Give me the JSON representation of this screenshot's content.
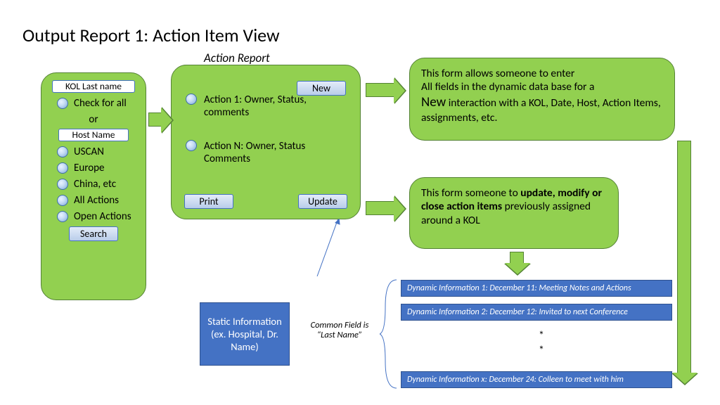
{
  "title": "Output Report 1: Action Item View",
  "action_report_label": "Action Report",
  "filters": {
    "kol_field": "KOL Last name",
    "check_all": "Check for all",
    "or": "or",
    "host_field": "Host Name",
    "regions": [
      "USCAN",
      "Europe",
      "China, etc"
    ],
    "all_actions": "All Actions",
    "open_actions": "Open Actions",
    "search": "Search"
  },
  "report": {
    "new": "New",
    "action1": "Action 1:  Owner, Status, comments",
    "actionN": "Action N: Owner, Status Comments",
    "print": "Print",
    "update": "Update"
  },
  "desc_new_1": "This form allows someone to enter",
  "desc_new_2": "All fields in the dynamic data base for a",
  "desc_new_big": "New",
  "desc_new_3": " interaction with a KOL, Date, Host, Action Items, assignments, etc.",
  "desc_update_1": "This form someone to ",
  "desc_update_bold": "update, modify or close action items",
  "desc_update_2": " previously assigned around a KOL",
  "static_info": "Static Information (ex. Hospital, Dr. Name)",
  "common_field": "Common Field is “Last Name”",
  "dyn": {
    "d1": "Dynamic Information 1:  December 11: Meeting Notes and Actions",
    "d2": "Dynamic Information 2:  December 12: Invited to next Conference",
    "d3": "Dynamic Information x:  December 24:  Colleen to meet with him"
  },
  "ast": "*\n*"
}
